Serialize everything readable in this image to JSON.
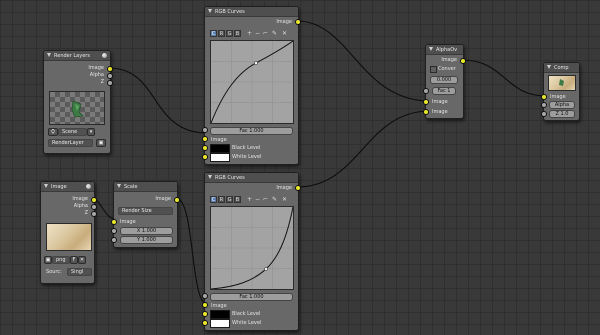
{
  "render_layers": {
    "title": "Render Layers",
    "outputs": [
      "Image",
      "Alpha",
      "Z"
    ],
    "scene": "Scene",
    "layer": "RenderLayer"
  },
  "curves_top": {
    "title": "RGB Curves",
    "output": "Image",
    "channels": [
      "C",
      "R",
      "G",
      "B"
    ],
    "tools": [
      "+",
      "−",
      "⌐",
      "✎",
      "✕"
    ],
    "fac": "Fac 1.000",
    "inputs": [
      "Image",
      "Black Level",
      "White Level"
    ]
  },
  "curves_bottom": {
    "title": "RGB Curves",
    "output": "Image",
    "channels": [
      "C",
      "R",
      "G",
      "B"
    ],
    "tools": [
      "+",
      "−",
      "⌐",
      "✎",
      "✕"
    ],
    "fac": "Fac 1.000",
    "inputs": [
      "Image",
      "Black Level",
      "White Level"
    ]
  },
  "image_node": {
    "title": "Image",
    "outputs": [
      "Image",
      "Alpha",
      "Z"
    ],
    "file": "png",
    "flag": "F",
    "source_label": "Sourc:",
    "source": "Singl"
  },
  "scale_node": {
    "title": "Scale",
    "output": "Image",
    "mode": "Render Size",
    "input": "Image",
    "x": "X 1.000",
    "y": "Y 1.000"
  },
  "alpha_over": {
    "title": "AlphaOv",
    "output": "Image",
    "convert": "Conver",
    "premul": "0.000",
    "fac": "Fac 1",
    "inputs": [
      "Image",
      "Image"
    ]
  },
  "composite": {
    "title": "Comp",
    "inputs": [
      "Image",
      "Alpha",
      "Z 1.0"
    ]
  }
}
